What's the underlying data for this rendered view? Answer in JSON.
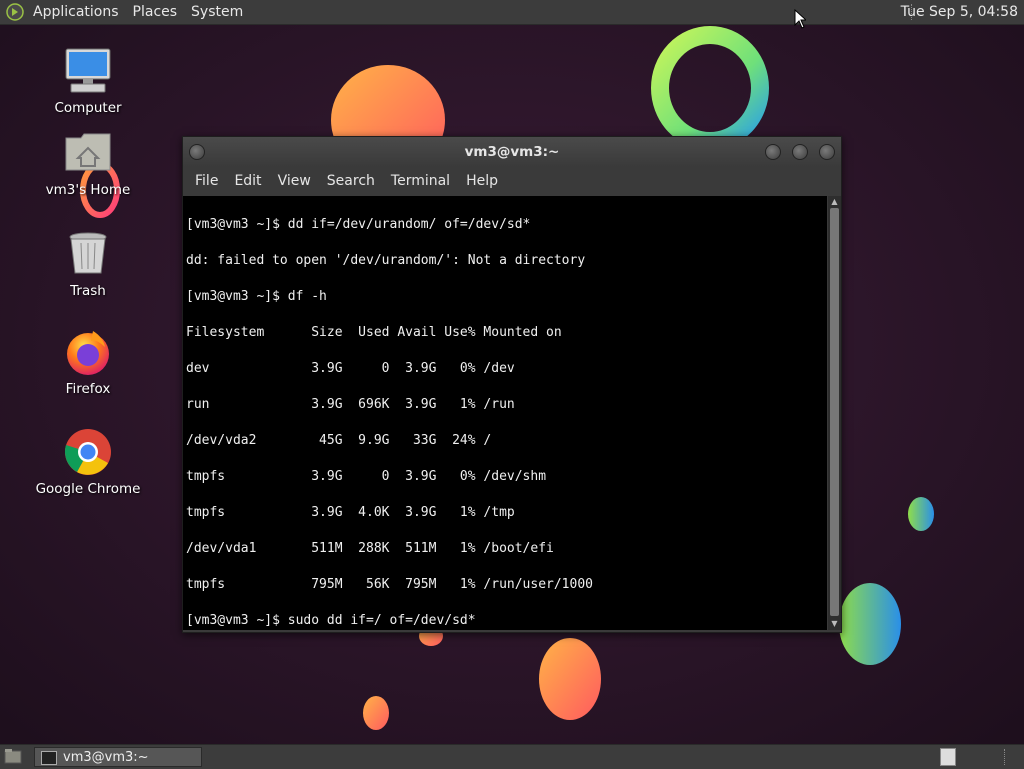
{
  "top_panel": {
    "menus": [
      "Applications",
      "Places",
      "System"
    ],
    "clock": "Tue Sep  5, 04:58"
  },
  "desktop_icons": [
    {
      "label": "Computer",
      "icon": "computer-icon"
    },
    {
      "label": "vm3's Home",
      "icon": "home-folder-icon"
    },
    {
      "label": "Trash",
      "icon": "trash-icon"
    },
    {
      "label": "Firefox",
      "icon": "firefox-icon"
    },
    {
      "label": "Google Chrome",
      "icon": "chrome-icon"
    }
  ],
  "window": {
    "title": "vm3@vm3:~",
    "menus": [
      "File",
      "Edit",
      "View",
      "Search",
      "Terminal",
      "Help"
    ],
    "lines": [
      "[vm3@vm3 ~]$ dd if=/dev/urandom/ of=/dev/sd*",
      "dd: failed to open '/dev/urandom/': Not a directory",
      "[vm3@vm3 ~]$ df -h",
      "Filesystem      Size  Used Avail Use% Mounted on",
      "dev             3.9G     0  3.9G   0% /dev",
      "run             3.9G  696K  3.9G   1% /run",
      "/dev/vda2        45G  9.9G   33G  24% /",
      "tmpfs           3.9G     0  3.9G   0% /dev/shm",
      "tmpfs           3.9G  4.0K  3.9G   1% /tmp",
      "/dev/vda1       511M  288K  511M   1% /boot/efi",
      "tmpfs           795M   56K  795M   1% /run/user/1000",
      "[vm3@vm3 ~]$ sudo dd if=/ of=/dev/sd*"
    ]
  },
  "taskbar": {
    "tasks": [
      "vm3@vm3:~"
    ]
  },
  "colors": {
    "wallpaper": "#2a1528",
    "panel": "#3c3c3c",
    "terminal_bg": "#000000",
    "terminal_fg": "#f0f0f0"
  }
}
